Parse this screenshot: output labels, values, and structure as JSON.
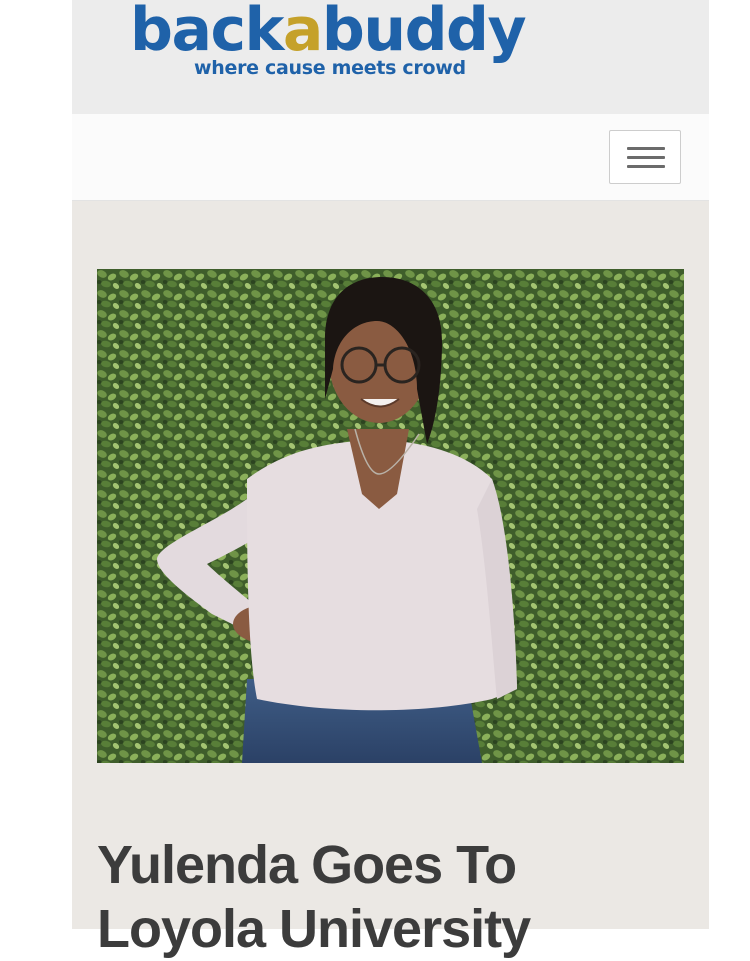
{
  "header": {
    "logo_prefix": "back",
    "logo_accent": "a",
    "logo_suffix": "buddy",
    "tagline": "where cause meets crowd",
    "brand_color": "#1f62a9",
    "accent_color": "#c5a12a"
  },
  "nav": {
    "menu_icon": "hamburger-menu-icon"
  },
  "campaign": {
    "photo_subject": "campaign-photo",
    "title_line1": "Yulenda Goes To",
    "title_line2": "Loyola University"
  }
}
